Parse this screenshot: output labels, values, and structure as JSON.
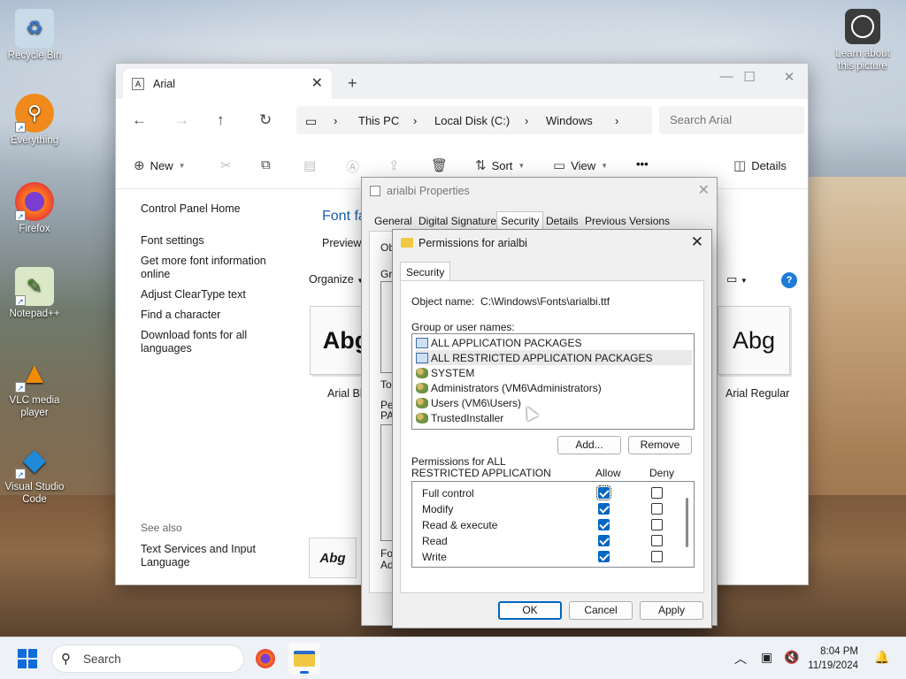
{
  "desktop": {
    "icons": [
      {
        "label": "Recycle Bin",
        "glyph": "♻"
      },
      {
        "label": "Everything",
        "glyph": "⚲"
      },
      {
        "label": "Firefox",
        "glyph": "●"
      },
      {
        "label": "Notepad++",
        "glyph": "✎"
      },
      {
        "label": "VLC media player",
        "glyph": "▲"
      },
      {
        "label": "Visual Studio Code",
        "glyph": "◆"
      }
    ],
    "learn_label": "Learn about this picture"
  },
  "explorer": {
    "tab_title": "Arial",
    "breadcrumb": [
      "This PC",
      "Local Disk (C:)",
      "Windows"
    ],
    "search_placeholder": "Search Arial",
    "commands": {
      "new": "New",
      "sort": "Sort",
      "view": "View",
      "more": "•••",
      "details": "Details"
    },
    "sidebar": {
      "control_panel_home": "Control Panel Home",
      "links": [
        "Font settings",
        "Get more font information online",
        "Adjust ClearType text",
        "Find a character",
        "Download fonts for all languages"
      ],
      "see_also": "See also",
      "text_services": "Text Services and Input Language"
    },
    "content": {
      "font_family_heading": "Font fa",
      "preview_text": "Preview,",
      "organize": "Organize",
      "tiles": [
        {
          "sample": "Abg",
          "label": "Arial Bla"
        },
        {
          "sample": "Abg",
          "label": "Arial Regular"
        }
      ],
      "bottom_sample": "Abg"
    }
  },
  "properties": {
    "title": "arialbi Properties",
    "tabs": [
      "General",
      "Digital Signatures",
      "Security",
      "Details",
      "Previous Versions"
    ],
    "active_tab": "Security",
    "fragments": [
      "Ob",
      "Gro",
      "To",
      "Pe",
      "PA",
      "Fo",
      "Ad"
    ]
  },
  "permissions": {
    "title": "Permissions for arialbi",
    "tab": "Security",
    "object_name_label": "Object name:",
    "object_name_value": "C:\\Windows\\Fonts\\arialbi.ttf",
    "group_label": "Group or user names:",
    "users": [
      {
        "name": "ALL APPLICATION PACKAGES",
        "type": "package",
        "selected": false
      },
      {
        "name": "ALL RESTRICTED APPLICATION PACKAGES",
        "type": "package",
        "selected": true
      },
      {
        "name": "SYSTEM",
        "type": "group",
        "selected": false
      },
      {
        "name": "Administrators (VM6\\Administrators)",
        "type": "group",
        "selected": false
      },
      {
        "name": "Users (VM6\\Users)",
        "type": "group",
        "selected": false
      },
      {
        "name": "TrustedInstaller",
        "type": "group",
        "selected": false
      }
    ],
    "add_button": "Add...",
    "remove_button": "Remove",
    "perm_label_line1": "Permissions for ALL",
    "perm_label_line2": "RESTRICTED APPLICATION",
    "allow_header": "Allow",
    "deny_header": "Deny",
    "rows": [
      {
        "name": "Full control",
        "allow": true,
        "deny": false
      },
      {
        "name": "Modify",
        "allow": true,
        "deny": false
      },
      {
        "name": "Read & execute",
        "allow": true,
        "deny": false
      },
      {
        "name": "Read",
        "allow": true,
        "deny": false
      },
      {
        "name": "Write",
        "allow": true,
        "deny": false
      }
    ],
    "ok": "OK",
    "cancel": "Cancel",
    "apply": "Apply"
  },
  "taskbar": {
    "search": "Search",
    "time": "8:04 PM",
    "date": "11/19/2024"
  },
  "colors": {
    "accent": "#0067c0",
    "start": "#0f6cd8",
    "link": "#1a5fa8"
  }
}
